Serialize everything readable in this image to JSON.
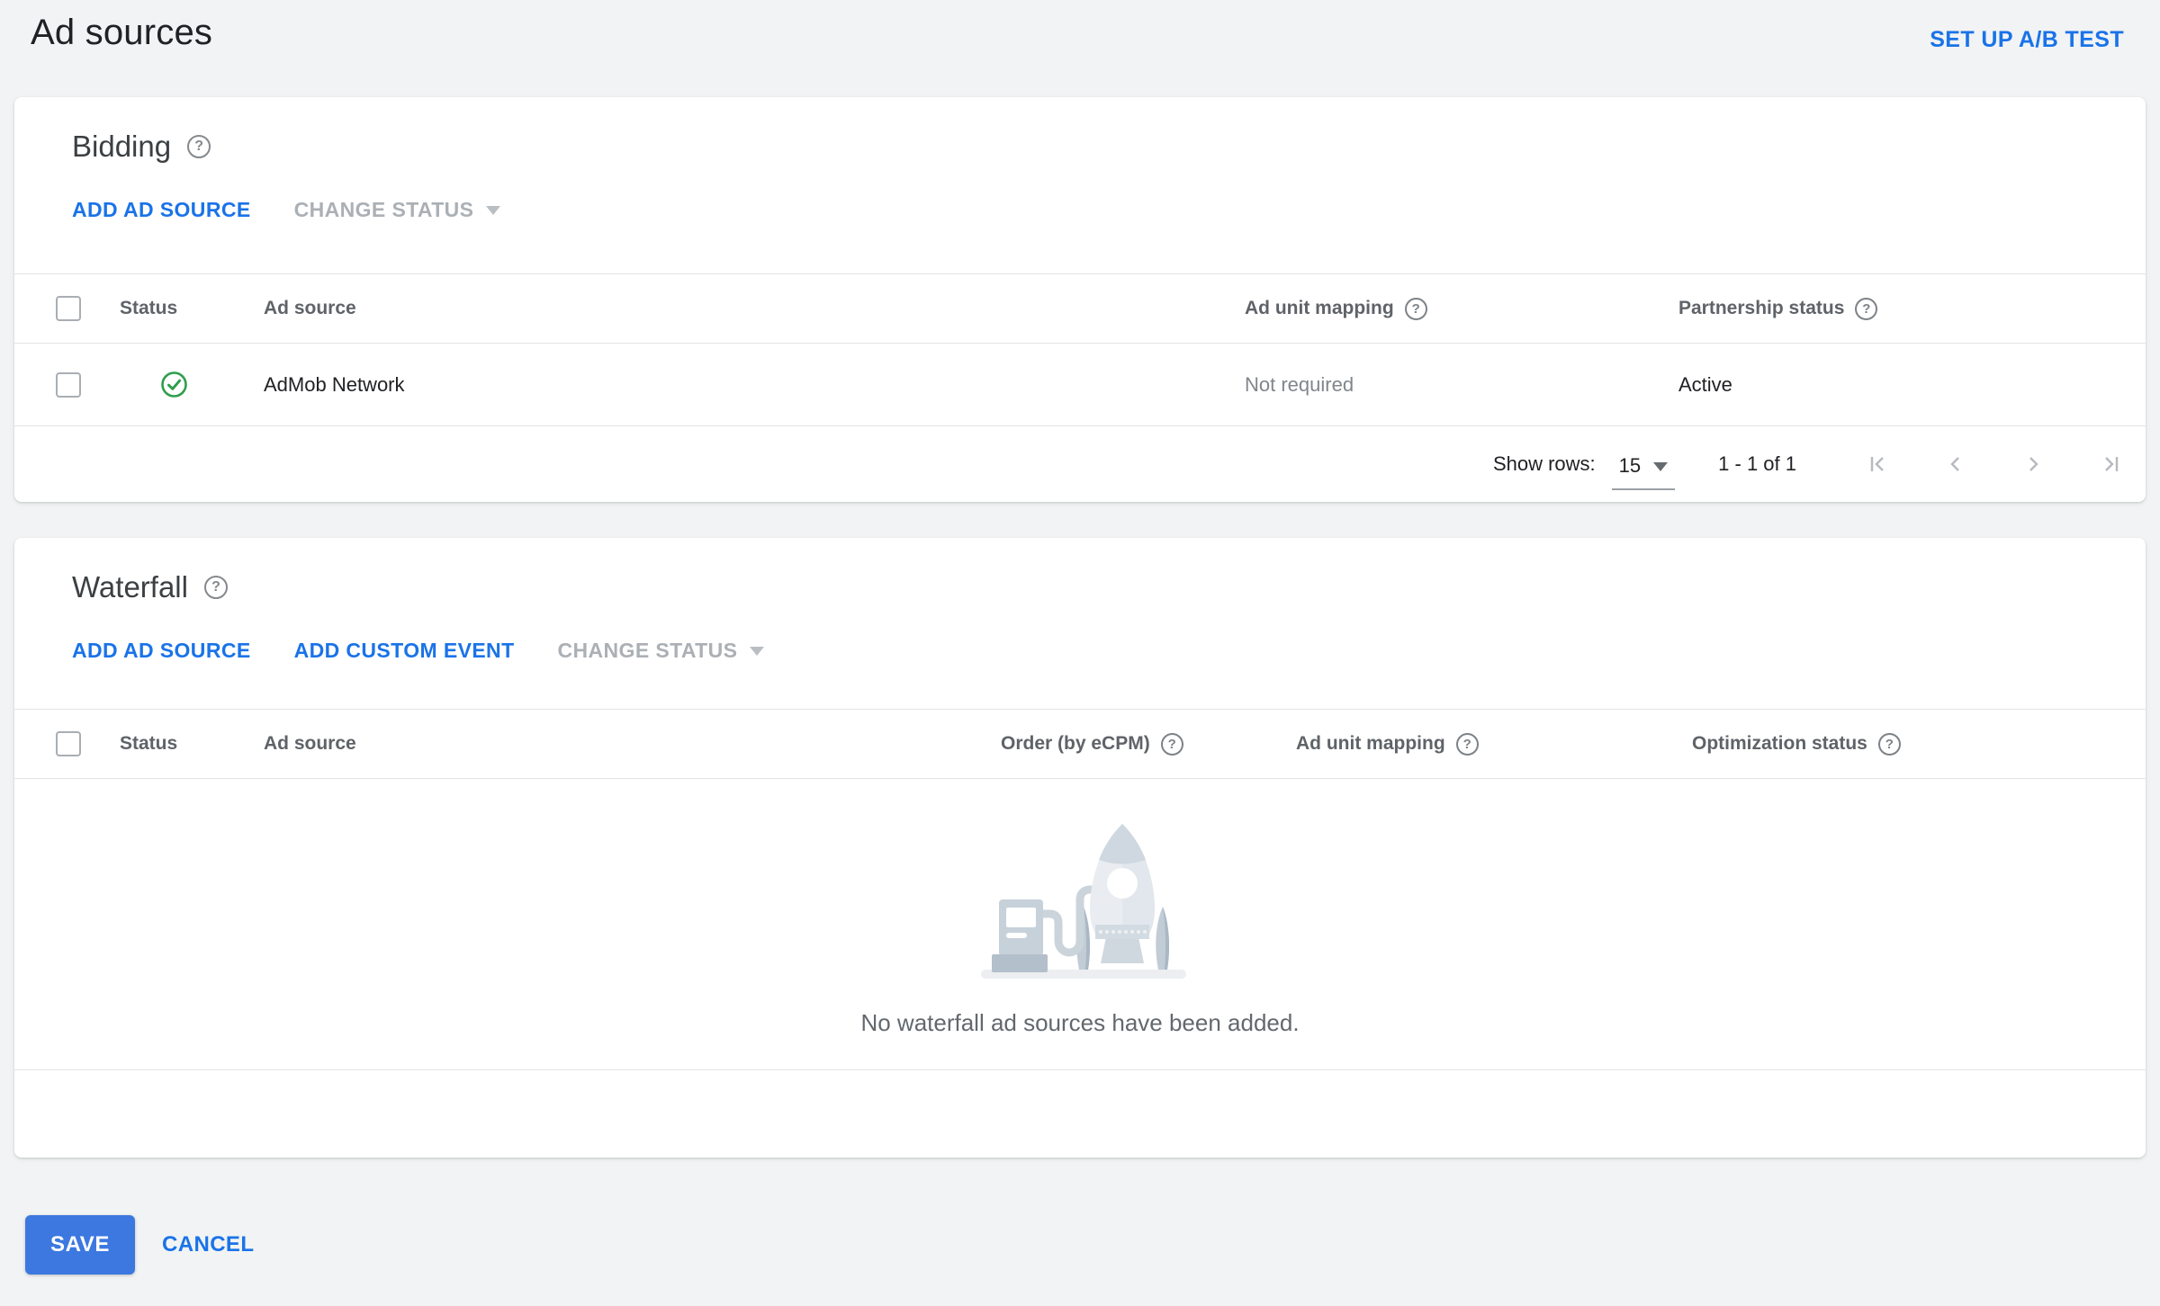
{
  "colors": {
    "link_blue": "#1a73e8",
    "save_blue": "#3c78e0",
    "success_green": "#2e9e4c",
    "disabled_gray": "#abb0b5"
  },
  "icons": {
    "help_glyph": "?"
  },
  "header": {
    "title": "Ad sources",
    "ab_test_link": "SET UP A/B TEST"
  },
  "bidding": {
    "title": "Bidding",
    "add_ad_source": "ADD AD SOURCE",
    "change_status": "CHANGE STATUS",
    "columns": {
      "status": "Status",
      "ad_source": "Ad source",
      "ad_unit_mapping": "Ad unit mapping",
      "partnership_status": "Partnership status"
    },
    "rows": [
      {
        "status_icon": "check-circle",
        "ad_source": "AdMob Network",
        "ad_unit_mapping": "Not required",
        "partnership_status": "Active"
      }
    ],
    "pagination": {
      "show_rows_label": "Show rows:",
      "rows_per_page": "15",
      "range": "1 - 1 of 1"
    }
  },
  "waterfall": {
    "title": "Waterfall",
    "add_ad_source": "ADD AD SOURCE",
    "add_custom_event": "ADD CUSTOM EVENT",
    "change_status": "CHANGE STATUS",
    "columns": {
      "status": "Status",
      "ad_source": "Ad source",
      "order": "Order (by eCPM)",
      "ad_unit_mapping": "Ad unit mapping",
      "optimization_status": "Optimization status"
    },
    "empty_state": {
      "illustration": "rocket-fuel-pump",
      "message": "No waterfall ad sources have been added."
    }
  },
  "footer": {
    "save": "SAVE",
    "cancel": "CANCEL"
  }
}
